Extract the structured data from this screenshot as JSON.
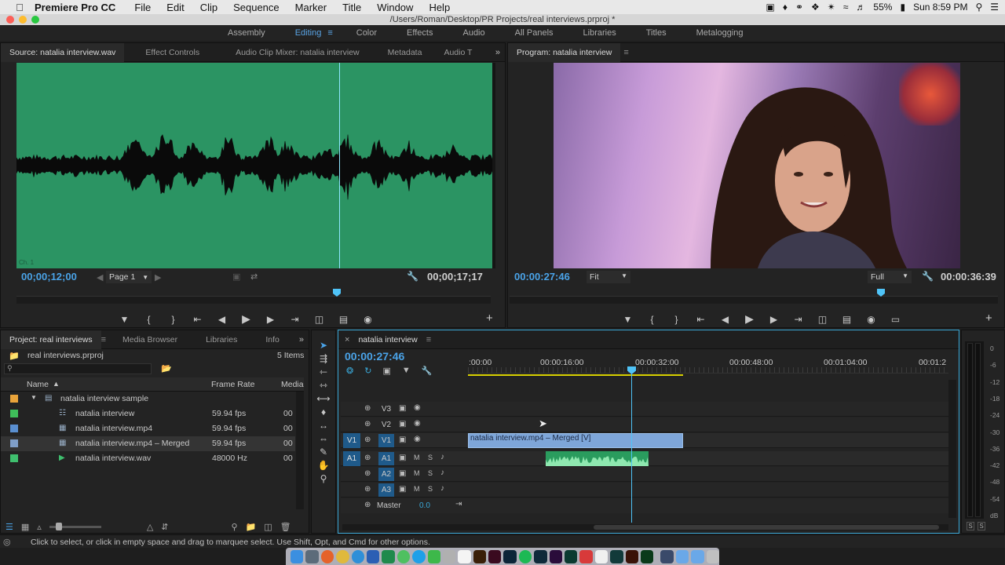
{
  "menubar": {
    "app_name": "Premiere Pro CC",
    "items": [
      "File",
      "Edit",
      "Clip",
      "Sequence",
      "Marker",
      "Title",
      "Window",
      "Help"
    ],
    "battery": "55%",
    "clock": "Sun 8:59 PM"
  },
  "window": {
    "title": "/Users/Roman/Desktop/PR Projects/real interviews.prproj *"
  },
  "workspaces": {
    "items": [
      {
        "label": "Assembly",
        "active": false
      },
      {
        "label": "Editing",
        "active": true
      },
      {
        "label": "Color",
        "active": false
      },
      {
        "label": "Effects",
        "active": false
      },
      {
        "label": "Audio",
        "active": false
      },
      {
        "label": "All Panels",
        "active": false
      },
      {
        "label": "Libraries",
        "active": false
      },
      {
        "label": "Titles",
        "active": false
      },
      {
        "label": "Metalogging",
        "active": false
      }
    ]
  },
  "source": {
    "tabs": [
      "Source: natalia interview.wav",
      "Effect Controls",
      "Audio Clip Mixer: natalia interview",
      "Metadata",
      "Audio T"
    ],
    "channel_label": "Ch. 1",
    "timecode_in": "00;00;12;00",
    "page_select": "Page 1",
    "timecode_out": "00;00;17;17",
    "playhead_fraction": 0.68
  },
  "program": {
    "tab": "Program: natalia interview",
    "timecode_in": "00:00:27:46",
    "fit": "Fit",
    "quality": "Full",
    "timecode_out": "00:00:36:39"
  },
  "project": {
    "tabs": [
      "Project: real interviews",
      "Media Browser",
      "Libraries",
      "Info"
    ],
    "file": "real interviews.prproj",
    "count": "5 Items",
    "columns": [
      "Name",
      "Frame Rate",
      "Media"
    ],
    "rows": [
      {
        "name": "natalia interview sample",
        "rate": "",
        "media": "",
        "color": "#e8a33a",
        "type": "folder"
      },
      {
        "name": "natalia interview",
        "rate": "59.94 fps",
        "media": "00",
        "color": "#3fbf5a",
        "type": "sequence"
      },
      {
        "name": "natalia interview.mp4",
        "rate": "59.94 fps",
        "media": "00",
        "color": "#5a8fd0",
        "type": "video"
      },
      {
        "name": "natalia interview.mp4 – Merged",
        "rate": "59.94 fps",
        "media": "00",
        "color": "#7f9ec8",
        "type": "merged"
      },
      {
        "name": "natalia interview.wav",
        "rate": "48000 Hz",
        "media": "00",
        "color": "#3fbf6e",
        "type": "audio"
      }
    ]
  },
  "timeline": {
    "tab": "natalia interview",
    "timecode": "00:00:27:46",
    "ruler": [
      ":00:00",
      "00:00:16:00",
      "00:00:32:00",
      "00:00:48:00",
      "00:01:04:00",
      "00:01:2"
    ],
    "video_tracks": [
      "V3",
      "V2",
      "V1"
    ],
    "audio_tracks": [
      "A1",
      "A2",
      "A3"
    ],
    "source_v": "V1",
    "source_a": "A1",
    "master_label": "Master",
    "master_value": "0.0",
    "clip_v": "natalia interview.mp4 – Merged [V]",
    "m_label": "M",
    "s_label": "S"
  },
  "meters": {
    "ticks": [
      "0",
      "-6",
      "-12",
      "-18",
      "-24",
      "-30",
      "-36",
      "-42",
      "-48",
      "-54",
      "dB"
    ],
    "solo": [
      "S",
      "S"
    ]
  },
  "status": {
    "text": "Click to select, or click in empty space and drag to marquee select. Use Shift, Opt, and Cmd for other options."
  },
  "colors": {
    "accent": "#4aa3e8",
    "waveform_bg": "#2b9463",
    "video_clip": "#7ea6d9",
    "audio_clip": "#2a9c5e"
  }
}
